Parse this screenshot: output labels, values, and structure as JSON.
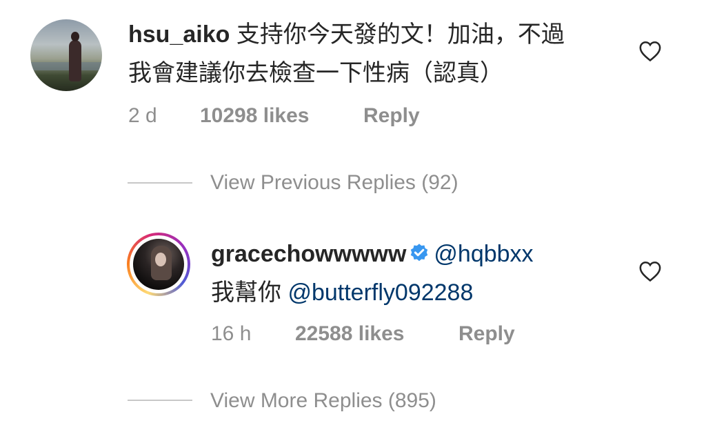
{
  "comment": {
    "username": "hsu_aiko",
    "text_line1": "支持你今天發的文！加油，不過",
    "text_line2": "我會建議你去檢查一下性病（認真）",
    "time": "2 d",
    "likes": "10298 likes",
    "reply": "Reply",
    "avatar_icon": "profile-photo"
  },
  "view_previous": "View Previous Replies (92)",
  "reply_comment": {
    "username": "gracechowwwww",
    "verified_icon": "verified-badge-icon",
    "mention1": "@hqbbxx",
    "text_prefix": "我幫你",
    "mention2": "@butterfly092288",
    "time": "16 h",
    "likes": "22588 likes",
    "reply": "Reply",
    "avatar_icon": "profile-photo-story-ring"
  },
  "view_more": "View More Replies (895)",
  "colors": {
    "text": "#262626",
    "muted": "#8e8e8e",
    "mention": "#00376b",
    "verified": "#3897f0",
    "divider": "#c7c7c7"
  }
}
